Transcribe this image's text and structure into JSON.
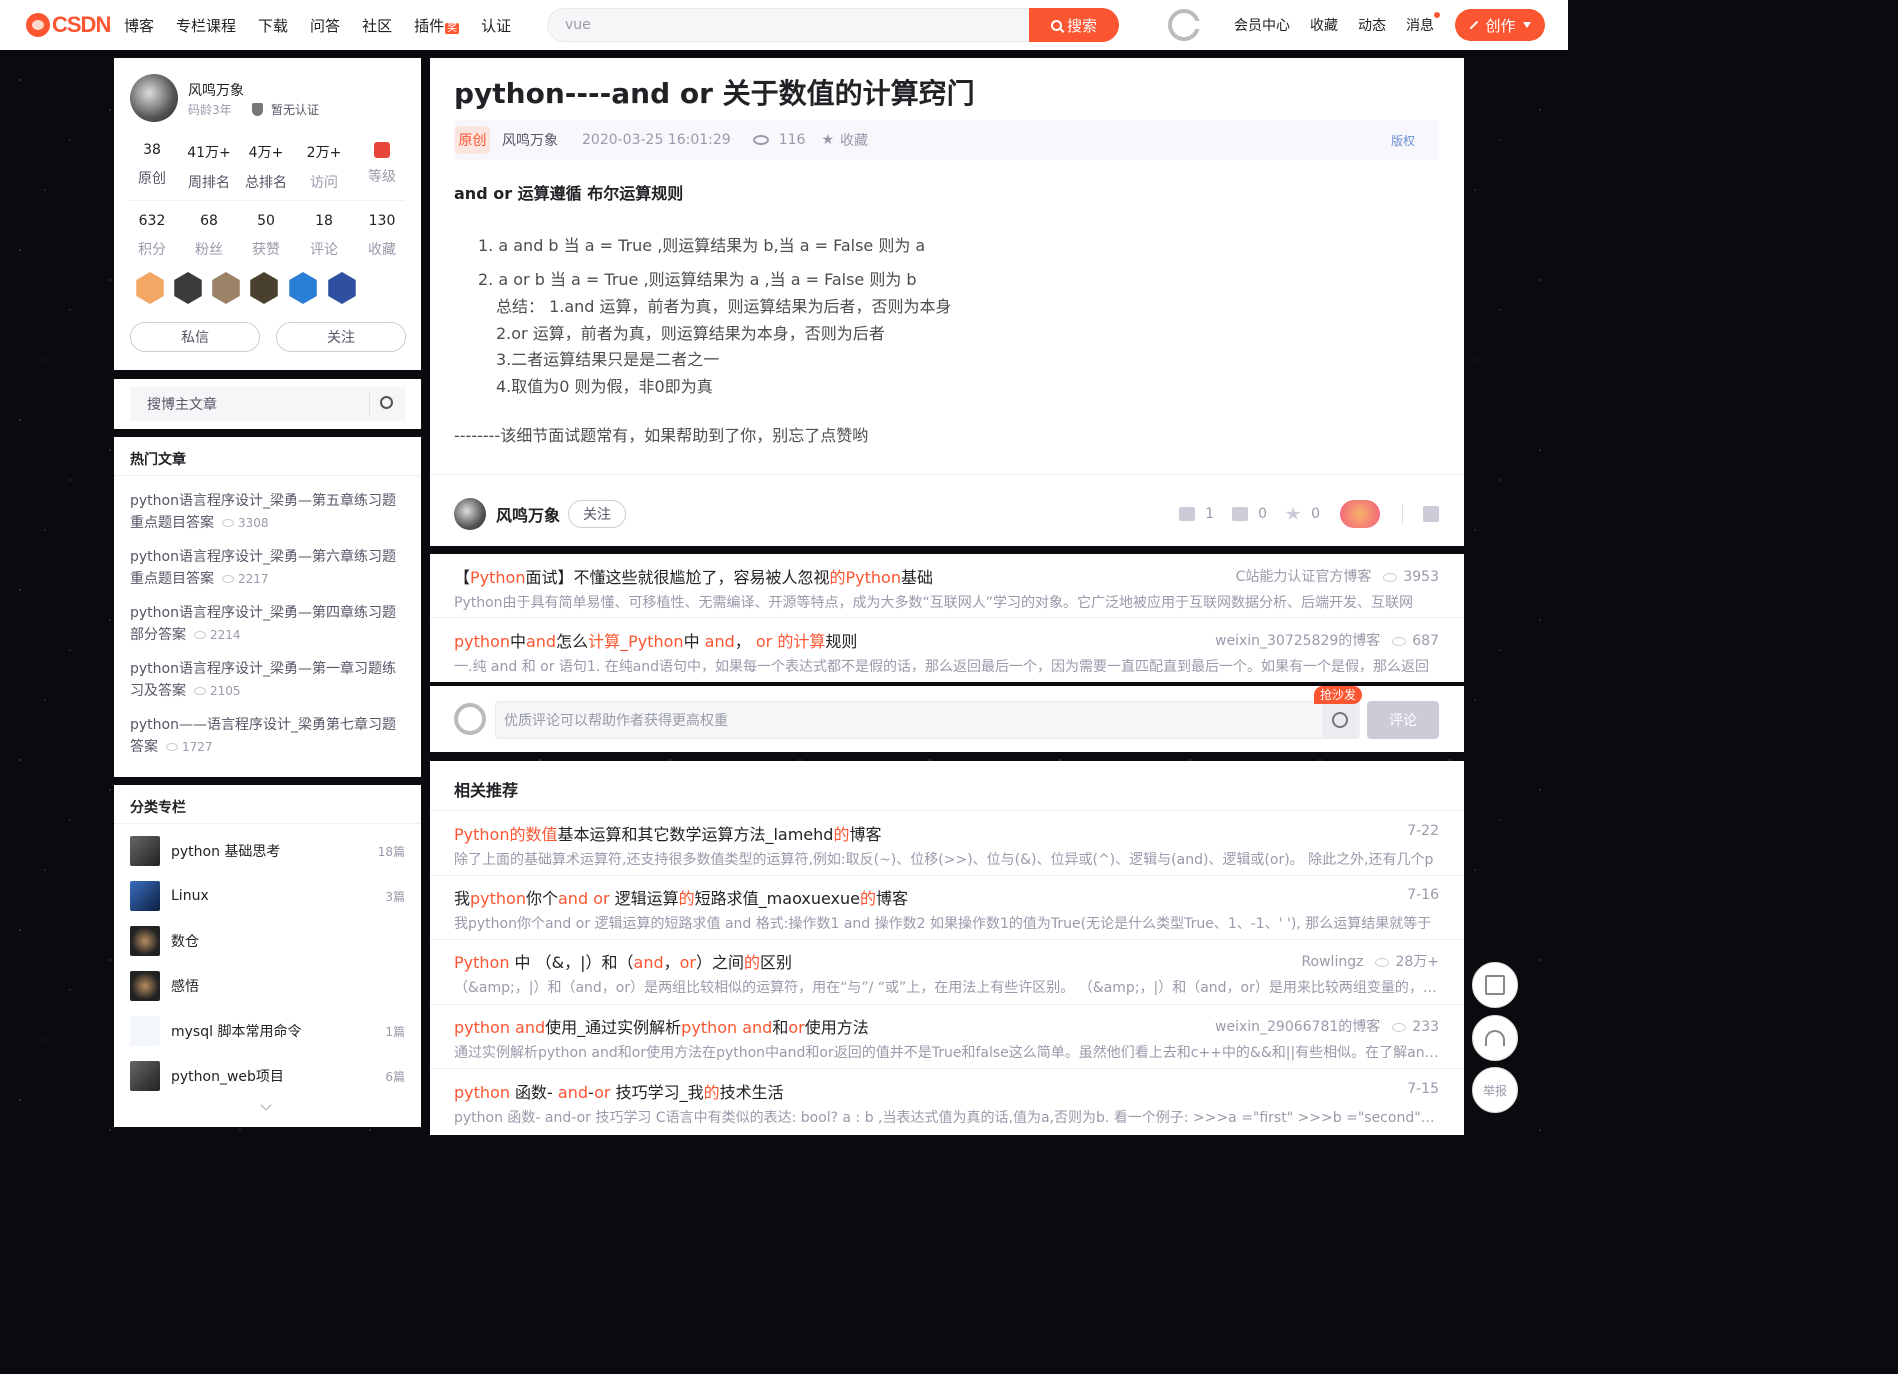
{
  "nav": {
    "logo": "CSDN",
    "items": [
      "博客",
      "专栏课程",
      "下载",
      "问答",
      "社区",
      "插件",
      "认证"
    ],
    "plugin_badge": "奖"
  },
  "search": {
    "value": "vue",
    "button": "搜索"
  },
  "rnav": {
    "items": [
      "会员中心",
      "收藏",
      "动态",
      "消息"
    ],
    "create": "创作"
  },
  "profile": {
    "name": "风鸣万象",
    "age": "码龄3年",
    "cert": "暂无认证",
    "stats1": [
      {
        "n": "38",
        "l": "原创"
      },
      {
        "n": "41万+",
        "l": "周排名"
      },
      {
        "n": "4万+",
        "l": "总排名"
      },
      {
        "n": "2万+",
        "l": "访问"
      },
      {
        "n": "",
        "l": "等级"
      }
    ],
    "stats2": [
      {
        "n": "632",
        "l": "积分"
      },
      {
        "n": "68",
        "l": "粉丝"
      },
      {
        "n": "50",
        "l": "获赞"
      },
      {
        "n": "18",
        "l": "评论"
      },
      {
        "n": "130",
        "l": "收藏"
      }
    ],
    "msg": "私信",
    "follow": "关注"
  },
  "blog_search": {
    "placeholder": "搜博主文章"
  },
  "hot": {
    "title": "热门文章",
    "items": [
      {
        "l1": "python语言程序设计_梁勇—第五章练习题",
        "l2": "重点题目答案",
        "cnt": "3308"
      },
      {
        "l1": "python语言程序设计_梁勇—第六章练习题",
        "l2": "重点题目答案",
        "cnt": "2217"
      },
      {
        "l1": "python语言程序设计_梁勇—第四章练习题",
        "l2": "部分答案",
        "cnt": "2214"
      },
      {
        "l1": "python语言程序设计_梁勇—第一章习题练",
        "l2": "习及答案",
        "cnt": "2105"
      },
      {
        "l1": "python——语言程序设计_梁勇第七章习题",
        "l2": "答案",
        "cnt": "1727"
      }
    ]
  },
  "cats": {
    "title": "分类专栏",
    "items": [
      {
        "name": "python 基础思考",
        "cnt": "18篇"
      },
      {
        "name": "Linux",
        "cnt": "3篇"
      },
      {
        "name": "数仓",
        "cnt": ""
      },
      {
        "name": "感悟",
        "cnt": ""
      },
      {
        "name": "mysql 脚本常用命令",
        "cnt": "1篇"
      },
      {
        "name": "python_web项目",
        "cnt": "6篇"
      }
    ]
  },
  "article": {
    "title": "python----and or 关于数值的计算窍门",
    "orig": "原创",
    "author": "风鸣万象",
    "date": "2020-03-25 16:01:29",
    "views": "116",
    "fav": "收藏",
    "copyright": "版权",
    "lead": "and or 运算遵循 布尔运算规则",
    "li1": "1. a and b 当 a = True ,则运算结果为 b,当 a = False 则为 a",
    "li2": "2. a or b 当 a = True ,则运算结果为 a ,当 a = False 则为 b",
    "sum1": "总结：  1.and 运算，前者为真，则运算结果为后者，否则为本身",
    "sum2": "2.or 运算，前者为真，则运算结果为本身，否则为后者",
    "sum3": "3.二者运算结果只是是二者之一",
    "sum4": "4.取值为0 则为假，非0即为真",
    "end": "--------该细节面试题常有，如果帮助到了你，别忘了点赞哟",
    "author_bar": {
      "name": "风鸣万象",
      "follow": "关注",
      "like": "1",
      "comment": "0",
      "star": "0"
    }
  },
  "rec_top": [
    {
      "t": "【Python面试】不懂这些就很尴尬了，容易被人忽视的Python基础",
      "author": "C站能力认证官方博客",
      "cnt": "3953",
      "d": "Python由于具有简单易懂、可移植性、无需编译、开源等特点，成为大多数“互联网人”学习的对象。它广泛地被应用于互联网数据分析、后端开发、互联网"
    },
    {
      "t": "python中and怎么计算_Python中 and， or 的计算规则",
      "author": "weixin_30725829的博客",
      "cnt": "687",
      "d": "一.纯 and 和 or 语句1. 在纯and语句中，如果每一个表达式都不是假的话，那么返回最后一个，因为需要一直匹配直到最后一个。如果有一个是假，那么返回"
    }
  ],
  "comment": {
    "placeholder": "优质评论可以帮助作者获得更高权重",
    "badge": "抢沙发",
    "btn": "评论"
  },
  "related": {
    "title": "相关推荐",
    "items": [
      {
        "t": "Python的数值基本运算和其它数学运算方法_lamehd的博客",
        "meta": "7-22",
        "d": "除了上面的基础算术运算符,还支持很多数值类型的运算符,例如:取反(~)、位移(>>)、位与(&)、位异或(^)、逻辑与(and)、逻辑或(or)。 除此之外,还有几个p"
      },
      {
        "t": "我python你个and or 逻辑运算的短路求值_maoxuexue的博客",
        "meta": "7-16",
        "d": "我python你个and or 逻辑运算的短路求值 and 格式:操作数1 and 操作数2 如果操作数1的值为True(无论是什么类型True、1、-1、' '), 那么运算结果就等于"
      },
      {
        "t": "Python 中 （&，|）和（and，or）之间的区别",
        "meta": "Rowlingz",
        "cnt": "28万+",
        "d": "（&amp;，|）和（and，or）是两组比较相似的运算符，用在“与”/ “或”上，在用法上有些许区别。 （&amp;，|）和（and，or）是用来比较两组变量的，格式"
      },
      {
        "t": "python and使用_通过实例解析python and和or使用方法",
        "meta": "weixin_29066781的博客",
        "cnt": "233",
        "d": "通过实例解析python and和or使用方法在python中and和or返回的值并不是True和false这么简单。虽然他们看上去和c++中的&&和||有些相似。在了解and和"
      },
      {
        "t": "python 函数- and-or 技巧学习_我的技术生活",
        "meta": "7-15",
        "d": "python 函数- and-or 技巧学习 C语言中有类似的表达: bool? a : b ,当表达式值为真的话,值为a,否则为b. 看一个例子: >>>a =\"first\" >>>b =\"second\" >>>1 and"
      }
    ]
  },
  "float": {
    "report": "举报"
  }
}
